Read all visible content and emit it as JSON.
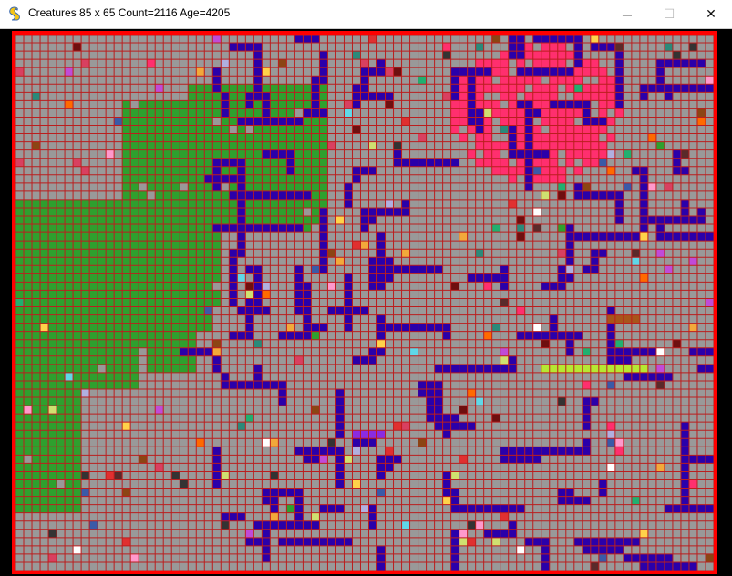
{
  "window": {
    "title": "Creatures 85 x 65 Count=2116 Age=4205",
    "minimize_glyph": "─",
    "maximize_glyph": "☐",
    "close_glyph": "✕",
    "app_icon": "snake-icon"
  },
  "simulation": {
    "cols": 85,
    "rows": 65,
    "count": 2116,
    "age": 4205
  },
  "colors": {
    "frame_border": "#ff0000",
    "grid_line": "#bb1e1e",
    "empty_cell": "#999999",
    "green_species": "#2ea02e",
    "blue_species": "#2a00aa",
    "pink_species": "#ff2f6e",
    "lime_species": "#b6e832",
    "brown_species": "#a8551a",
    "purple_species": "#8a2be2",
    "sparse_palette": [
      "#2ea02e",
      "#ff2f6e",
      "#ffd24a",
      "#6e0f0f",
      "#3a5aa8",
      "#c04bd8",
      "#f2a93b",
      "#5fd8e8",
      "#d84060",
      "#2a8a7a",
      "#b0b0e0",
      "#ff6a00",
      "#8b4513",
      "#cfe070",
      "#ff99cc",
      "#5a2a2a",
      "#e03030",
      "#20b070",
      "#ffffff",
      "#333333"
    ]
  }
}
